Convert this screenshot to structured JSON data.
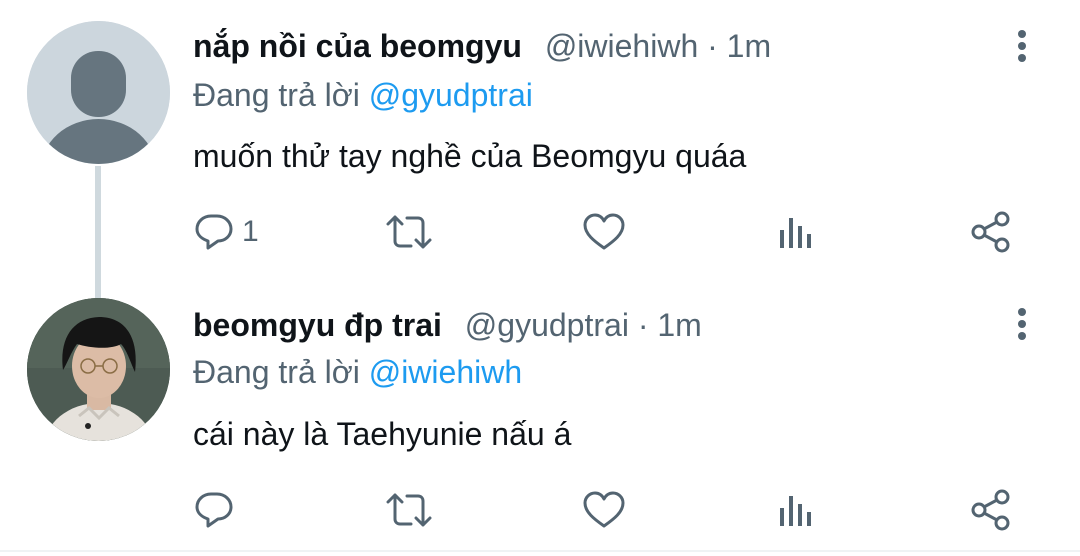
{
  "tweets": [
    {
      "display_name": "nắp nồi của beomgyu",
      "handle": "@iwiehiwh",
      "separator": "·",
      "time": "1m",
      "replying_prefix": "Đang trả lời",
      "replying_to": "@gyudptrai",
      "text": "muốn thử tay nghề của Beomgyu quáa",
      "reply_count": "1",
      "avatar": "default-avatar-icon"
    },
    {
      "display_name": "beomgyu đp trai",
      "handle": "@gyudptrai",
      "separator": "·",
      "time": "1m",
      "replying_prefix": "Đang trả lời",
      "replying_to": "@iwiehiwh",
      "text": "cái này là Taehyunie nấu á",
      "reply_count": "",
      "avatar": "user-photo-avatar"
    }
  ],
  "icons": {
    "reply": "reply-icon",
    "retweet": "retweet-icon",
    "like": "heart-icon",
    "views": "views-icon",
    "share": "share-icon",
    "more": "more-vertical-icon"
  },
  "colors": {
    "text_primary": "#0f1419",
    "text_secondary": "#536471",
    "accent": "#1d9bf0",
    "thread_line": "#cfd9de",
    "default_avatar_bg": "#ccd6dd",
    "default_avatar_fg": "#66757f"
  }
}
